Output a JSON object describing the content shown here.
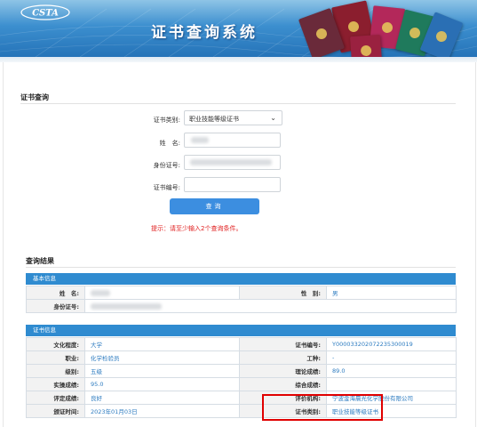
{
  "banner": {
    "logo_text": "CSTA",
    "title": "证书查询系统"
  },
  "query": {
    "section_title": "证书查询",
    "cert_type_label": "证书类别:",
    "cert_type_value": "职业技能等级证书",
    "name_label": "姓　名:",
    "id_label": "身份证号:",
    "cert_no_label": "证书编号:",
    "submit_label": "查询",
    "tip": "提示：请至少输入2个查询条件。"
  },
  "result": {
    "section_title": "查询结果",
    "basic": {
      "header": "基本信息",
      "name_label": "姓　名:",
      "gender_label": "性　别:",
      "gender_value": "男",
      "id_label": "身份证号:"
    },
    "cert": {
      "header": "证书信息",
      "rows": [
        {
          "l1": "文化程度:",
          "v1": "大学",
          "l2": "证书编号:",
          "v2": "Y000033202072235300019"
        },
        {
          "l1": "职业:",
          "v1": "化学检验员",
          "l2": "工种:",
          "v2": "-"
        },
        {
          "l1": "级别:",
          "v1": "五级",
          "l2": "理论成绩:",
          "v2": "89.0"
        },
        {
          "l1": "实操成绩:",
          "v1": "95.0",
          "l2": "综合成绩:",
          "v2": ""
        },
        {
          "l1": "评定成绩:",
          "v1": "良好",
          "l2": "评价机构:",
          "v2": "宁波金海晨光化学股份有限公司"
        },
        {
          "l1": "颁证时间:",
          "v1": "2023年01月03日",
          "l2": "证书类别:",
          "v2": "职业技能等级证书"
        }
      ]
    }
  },
  "colors": {
    "accent": "#2f8bd0",
    "button": "#3c8ee0",
    "tip": "#e02020",
    "highlight": "#e00000"
  }
}
